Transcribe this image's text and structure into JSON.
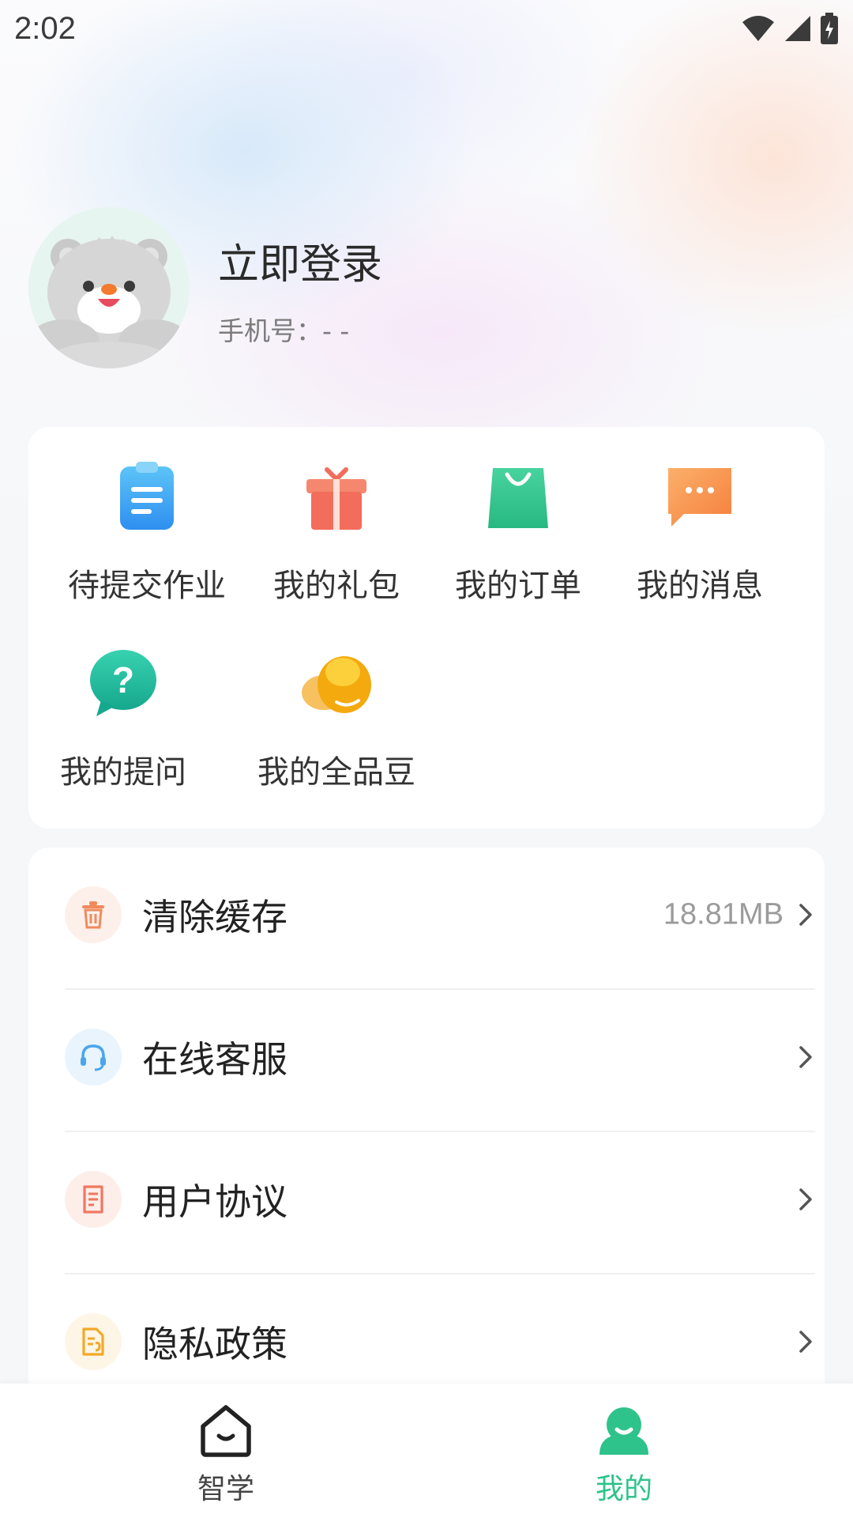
{
  "status_bar": {
    "time": "2:02",
    "icons": [
      "wifi-icon",
      "signal-icon",
      "battery-charging-icon"
    ]
  },
  "profile": {
    "name": "立即登录",
    "phone": "手机号：- -",
    "avatar": "bear-avatar"
  },
  "quick_actions": [
    {
      "label": "待提交作业",
      "icon": "clipboard-icon",
      "color": "#3aa8f0"
    },
    {
      "label": "我的礼包",
      "icon": "gift-icon",
      "color": "#f26d5b"
    },
    {
      "label": "我的订单",
      "icon": "shopping-bag-icon",
      "color": "#2fc48d"
    },
    {
      "label": "我的消息",
      "icon": "message-icon",
      "color": "#f7954b"
    },
    {
      "label": "我的提问",
      "icon": "question-bubble-icon",
      "color": "#1fb89a"
    },
    {
      "label": "我的全品豆",
      "icon": "beans-icon",
      "color": "#f5b419"
    }
  ],
  "settings_list": [
    {
      "label": "清除缓存",
      "value": "18.81MB",
      "icon": "trash-icon",
      "color": "#f08a5d",
      "bg": "#fdf0ea"
    },
    {
      "label": "在线客服",
      "value": "",
      "icon": "headset-icon",
      "color": "#4aa6ec",
      "bg": "#e9f4fd"
    },
    {
      "label": "用户协议",
      "value": "",
      "icon": "document-icon",
      "color": "#f0775f",
      "bg": "#fdeeea"
    },
    {
      "label": "隐私政策",
      "value": "",
      "icon": "privacy-doc-icon",
      "color": "#f2a928",
      "bg": "#fdf5e6"
    }
  ],
  "tabs": [
    {
      "label": "智学",
      "icon": "home-icon",
      "active": false
    },
    {
      "label": "我的",
      "icon": "profile-tab-icon",
      "active": true
    }
  ],
  "colors": {
    "accent": "#2ec38a",
    "tab_inactive": "#444444"
  }
}
